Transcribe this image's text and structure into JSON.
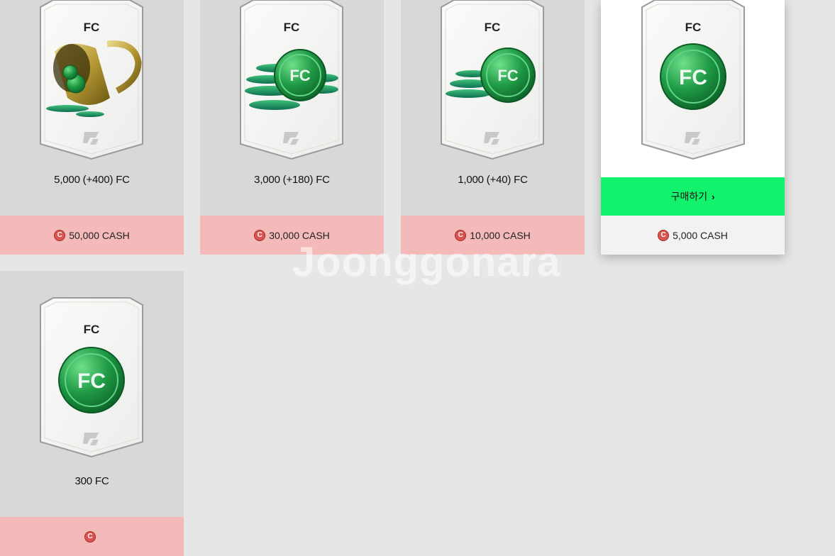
{
  "products": [
    {
      "card_label": "FC",
      "name": "5,000 (+400) FC",
      "price": "50,000 CASH",
      "art": "coin-bucket"
    },
    {
      "card_label": "FC",
      "name": "3,000 (+180) FC",
      "price": "30,000 CASH",
      "art": "coin-stack-large"
    },
    {
      "card_label": "FC",
      "name": "1,000 (+40) FC",
      "price": "10,000 CASH",
      "art": "coin-stack-small"
    },
    {
      "card_label": "FC",
      "buy_label": "구매하기",
      "price": "5,000 CASH",
      "art": "single-coin"
    },
    {
      "card_label": "FC",
      "name": "300 FC",
      "price": "",
      "art": "single-coin"
    }
  ],
  "coin_text": "FC",
  "watermark": "Joonggonara",
  "colors": {
    "buy_green": "#13f26c",
    "price_pink": "#f4b9b9",
    "cash_red": "#d9534f",
    "coin_green": "#1f9a45"
  },
  "icons": {
    "cash": "cash-coin-icon",
    "chevron": "chevron-right-icon",
    "brand": "fc-logo-icon"
  }
}
